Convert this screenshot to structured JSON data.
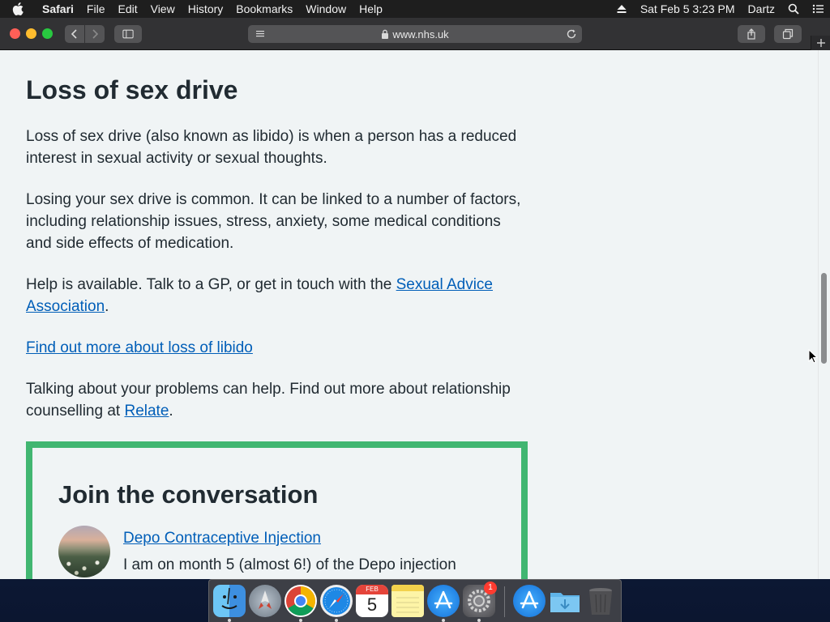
{
  "menubar": {
    "app_name": "Safari",
    "items": [
      "File",
      "Edit",
      "View",
      "History",
      "Bookmarks",
      "Window",
      "Help"
    ],
    "datetime": "Sat Feb 5  3:23 PM",
    "user": "Dartz"
  },
  "browser": {
    "url": "www.nhs.uk"
  },
  "page": {
    "title": "Loss of sex drive",
    "para1": "Loss of sex drive (also known as libido) is when a person has a reduced interest in sexual activity or sexual thoughts.",
    "para2": "Losing your sex drive is common. It can be linked to a number of factors, including relationship issues, stress, anxiety, some medical conditions and side effects of medication.",
    "para3_prefix": "Help is available. Talk to a GP, or get in touch with the ",
    "para3_link": "Sexual Advice Association",
    "para3_suffix": ".",
    "more_link": "Find out more about loss of libido",
    "para5_prefix": "Talking about your problems can help. Find out more about relationship counselling at ",
    "para5_link": "Relate",
    "para5_suffix": "."
  },
  "conversation": {
    "title": "Join the conversation",
    "post_title": "Depo Contraceptive Injection",
    "post_excerpt": "I am on month 5 (almost 6!) of the Depo injection"
  },
  "dock": {
    "calendar_month": "FEB",
    "calendar_day": "5",
    "settings_badge": "1",
    "colors": {
      "finder": "#3d9be9",
      "launchpad": "#8e9aa6",
      "chrome_red": "#db4437",
      "safari": "#1e88e5",
      "appstore": "#1d8cf2"
    }
  },
  "colors": {
    "link": "#005eb8",
    "text": "#212b32",
    "page_bg": "#f0f4f5",
    "conversation_border": "#41b671"
  }
}
